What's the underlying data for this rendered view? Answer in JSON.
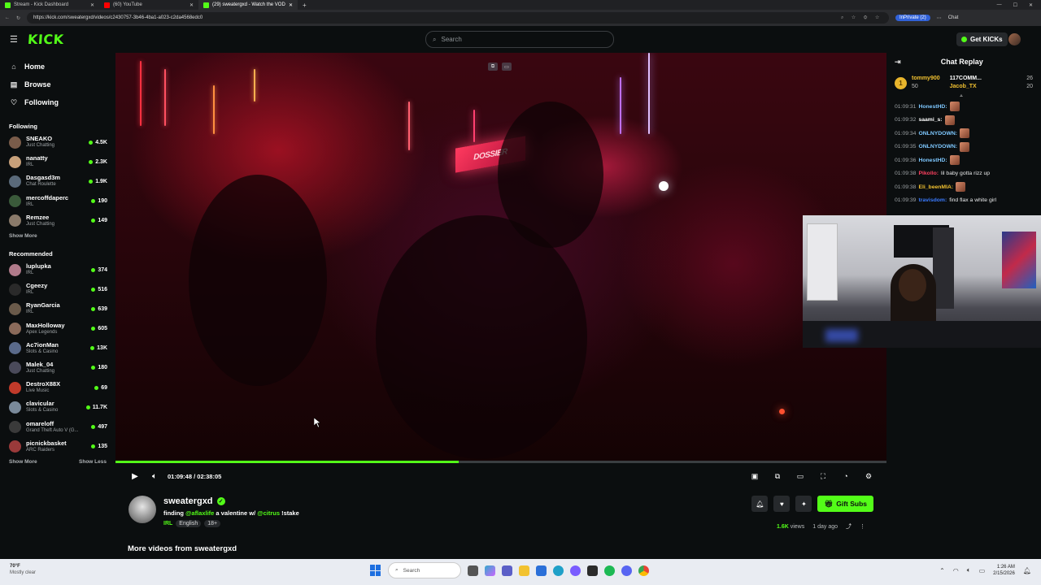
{
  "browser": {
    "tabs": [
      {
        "label": "Stream - Kick Dashboard",
        "color": "#53fc18"
      },
      {
        "label": "(60) YouTube",
        "color": "#ff0000"
      },
      {
        "label": "(29) sweatergxd - Watch the VOD",
        "color": "#53fc18"
      }
    ],
    "url": "https://kick.com/sweatergxd/videos/c2430757-3b46-4ba1-a023-c2da4568edc0",
    "inprivate_label": "InPrivate (2)",
    "chat_label": "Chat"
  },
  "header": {
    "logo": "KICK",
    "search_placeholder": "Search",
    "get_kicks": "Get KICKs"
  },
  "sidebar": {
    "nav": [
      {
        "label": "Home",
        "icon": "home-icon"
      },
      {
        "label": "Browse",
        "icon": "browse-icon"
      },
      {
        "label": "Following",
        "icon": "heart-icon"
      }
    ],
    "following_title": "Following",
    "following": [
      {
        "name": "SNEAKO",
        "category": "Just Chatting",
        "viewers": "4.5K",
        "color": "#7a5c4a"
      },
      {
        "name": "nanatty",
        "category": "IRL",
        "viewers": "2.3K",
        "color": "#c7a07a"
      },
      {
        "name": "Dasgasd3m",
        "category": "Chat Roulette",
        "viewers": "1.9K",
        "color": "#5a6a7a"
      },
      {
        "name": "mercoffdaperc",
        "category": "IRL",
        "viewers": "190",
        "color": "#3a5a3a"
      },
      {
        "name": "Remzee",
        "category": "Just Chatting",
        "viewers": "149",
        "color": "#8a7a6a"
      }
    ],
    "show_more": "Show More",
    "recommended_title": "Recommended",
    "recommended": [
      {
        "name": "luplupka",
        "category": "IRL",
        "viewers": "374",
        "color": "#b07a8a"
      },
      {
        "name": "Cgeezy",
        "category": "IRL",
        "viewers": "516",
        "color": "#2a2a2a"
      },
      {
        "name": "RyanGarcia",
        "category": "IRL",
        "viewers": "639",
        "color": "#6a5a4a"
      },
      {
        "name": "MaxHolloway",
        "category": "Apex Legends",
        "viewers": "605",
        "color": "#8a6a5a"
      },
      {
        "name": "Ac7ionMan",
        "category": "Slots & Casino",
        "viewers": "13K",
        "color": "#5a6a8a"
      },
      {
        "name": "Malek_04",
        "category": "Just Chatting",
        "viewers": "180",
        "color": "#4a4a5a"
      },
      {
        "name": "DestroX88X",
        "category": "Live Music",
        "viewers": "69",
        "color": "#c03a2a"
      },
      {
        "name": "clavicular",
        "category": "Slots & Casino",
        "viewers": "11.7K",
        "color": "#7a8a9a"
      },
      {
        "name": "omareloff",
        "category": "Grand Theft Auto V (G...",
        "viewers": "497",
        "color": "#3a3a3a"
      },
      {
        "name": "picnickbasket",
        "category": "ARC Raiders",
        "viewers": "135",
        "color": "#9a3a3a"
      }
    ],
    "show_less": "Show Less"
  },
  "video": {
    "sign_text": "DOSSIER",
    "progress": 0.445,
    "time": "01:09:48 / 02:38:05"
  },
  "stream": {
    "name": "sweatergxd",
    "title_prefix": "finding ",
    "mention1": "@aflaxlife",
    "title_mid": " a valentine w/ ",
    "mention2": "@citrus",
    "title_suffix": " !stake",
    "category": "IRL",
    "tags": [
      "English",
      "18+"
    ],
    "gift_subs": "Gift Subs",
    "views": "1.6K",
    "views_label": "views",
    "age": "1 day ago",
    "more_videos": "More videos from sweatergxd"
  },
  "chat": {
    "title": "Chat Replay",
    "leaderboard": {
      "rank": "1",
      "left_name": "tommy900",
      "left_value": "50",
      "right_top": "117COMM...",
      "right_top_count": "26",
      "right_bottom": "Jacob_TX",
      "right_bottom_count": "20"
    },
    "messages": [
      {
        "time": "01:09:31",
        "user": "HonestHD:",
        "text": "",
        "color": "#7ec8ff",
        "emote": true
      },
      {
        "time": "01:09:32",
        "user": "saami_s:",
        "text": "",
        "color": "#ffffff",
        "emote": true
      },
      {
        "time": "01:09:34",
        "user": "ONLNYDOWN:",
        "text": "",
        "color": "#7ec8ff",
        "emote": true
      },
      {
        "time": "01:09:35",
        "user": "ONLNYDOWN:",
        "text": "",
        "color": "#7ec8ff",
        "emote": true
      },
      {
        "time": "01:09:36",
        "user": "HonestHD:",
        "text": "",
        "color": "#7ec8ff",
        "emote": true
      },
      {
        "time": "01:09:38",
        "user": "Pikollo:",
        "text": "lil baby gotta rizz up",
        "color": "#ff4060",
        "emote": false
      },
      {
        "time": "01:09:38",
        "user": "Eli_beenMIA:",
        "text": "",
        "color": "#f0c030",
        "emote": true
      },
      {
        "time": "01:09:39",
        "user": "travisdom:",
        "text": "find flax a white girl",
        "color": "#3a7bff",
        "emote": false
      }
    ]
  },
  "taskbar": {
    "temp": "70°F",
    "condition": "Mostly clear",
    "search": "Search",
    "time": "1:26 AM",
    "date": "2/15/2026"
  },
  "colors": {
    "accent": "#53fc18",
    "background": "#0b0e0f"
  }
}
